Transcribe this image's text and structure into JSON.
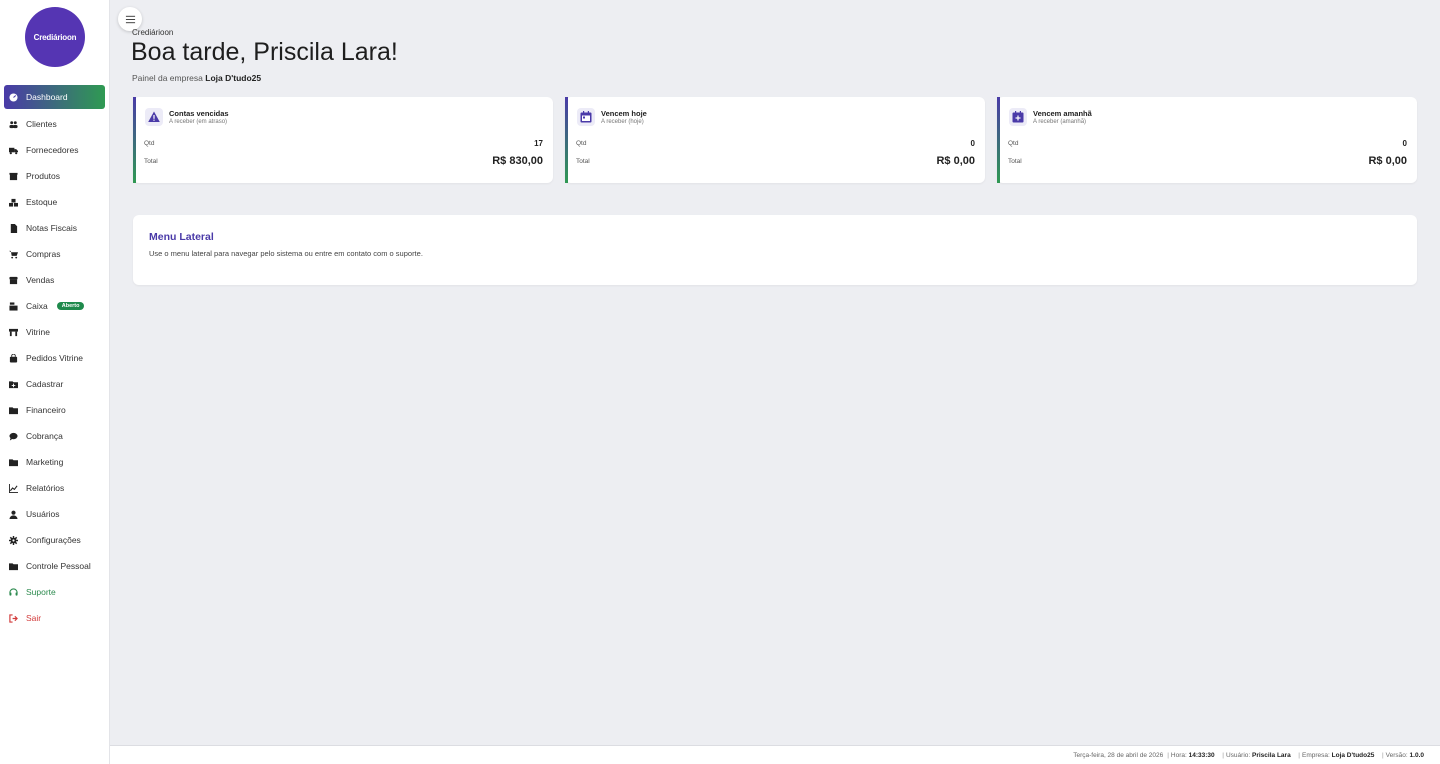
{
  "sidebar": {
    "logo_text": "Crediárioon",
    "items": [
      {
        "label": "Dashboard",
        "icon": "dashboard-icon"
      },
      {
        "label": "Clientes",
        "icon": "users-icon"
      },
      {
        "label": "Fornecedores",
        "icon": "truck-icon"
      },
      {
        "label": "Produtos",
        "icon": "box-icon"
      },
      {
        "label": "Estoque",
        "icon": "boxes-icon"
      },
      {
        "label": "Notas Fiscais",
        "icon": "file-icon"
      },
      {
        "label": "Compras",
        "icon": "cart-icon"
      },
      {
        "label": "Vendas",
        "icon": "store-icon"
      },
      {
        "label": "Caixa",
        "icon": "cash-register-icon",
        "badge": "Aberto"
      },
      {
        "label": "Vitrine",
        "icon": "storefront-icon"
      },
      {
        "label": "Pedidos Vitrine",
        "icon": "bag-icon"
      },
      {
        "label": "Cadastrar",
        "icon": "folder-plus-icon"
      },
      {
        "label": "Financeiro",
        "icon": "wallet-icon"
      },
      {
        "label": "Cobrança",
        "icon": "chat-icon"
      },
      {
        "label": "Marketing",
        "icon": "megaphone-icon"
      },
      {
        "label": "Relatórios",
        "icon": "chart-icon"
      },
      {
        "label": "Usuários",
        "icon": "user-icon"
      },
      {
        "label": "Configurações",
        "icon": "gear-icon"
      },
      {
        "label": "Controle Pessoal",
        "icon": "wallet-icon"
      },
      {
        "label": "Suporte",
        "icon": "headset-icon"
      },
      {
        "label": "Sair",
        "icon": "logout-icon"
      }
    ]
  },
  "header": {
    "brand": "Crediárioon",
    "greeting": "Boa tarde, Priscila Lara!",
    "company_prefix": "Painel da empresa",
    "company_name": "Loja D'tudo25"
  },
  "cards": [
    {
      "title": "Contas vencidas",
      "subtitle": "A receber (em atraso)",
      "icon": "warning-icon",
      "qty_label": "Qtd",
      "qty": "17",
      "total_label": "Total",
      "total": "R$ 830,00"
    },
    {
      "title": "Vencem hoje",
      "subtitle": "A receber (hoje)",
      "icon": "calendar-icon",
      "qty_label": "Qtd",
      "qty": "0",
      "total_label": "Total",
      "total": "R$ 0,00"
    },
    {
      "title": "Vencem amanhã",
      "subtitle": "A receber (amanhã)",
      "icon": "calendar-plus-icon",
      "qty_label": "Qtd",
      "qty": "0",
      "total_label": "Total",
      "total": "R$ 0,00"
    }
  ],
  "panel": {
    "title": "Menu Lateral",
    "text": "Use o menu lateral para navegar pelo sistema ou entre em contato com o suporte."
  },
  "footer": {
    "date": "Terça-feira, 28 de abril de 2026",
    "hora_label": "Hora:",
    "hora": "14:33:30",
    "usuario_label": "Usuário:",
    "usuario": "Priscila Lara",
    "empresa_label": "Empresa:",
    "empresa": "Loja D'tudo25",
    "versao_label": "Versão:",
    "versao": "1.0.0"
  },
  "colors": {
    "accent_purple": "#4a3aa8",
    "accent_green": "#2f9a52",
    "logout_red": "#d23b3b"
  }
}
